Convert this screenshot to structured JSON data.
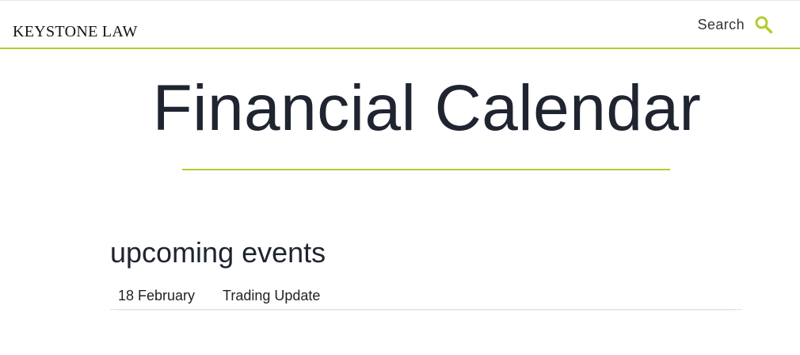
{
  "header": {
    "logo_text": "KEYSTONE LAW",
    "search_label": "Search"
  },
  "page": {
    "title": "Financial Calendar"
  },
  "events": {
    "heading": "upcoming events",
    "rows": [
      {
        "date": "18 February",
        "name": "Trading Update"
      }
    ]
  },
  "colors": {
    "accent": "#b5cc2d",
    "text": "#1f2430"
  },
  "icons": {
    "search": "search-icon"
  }
}
